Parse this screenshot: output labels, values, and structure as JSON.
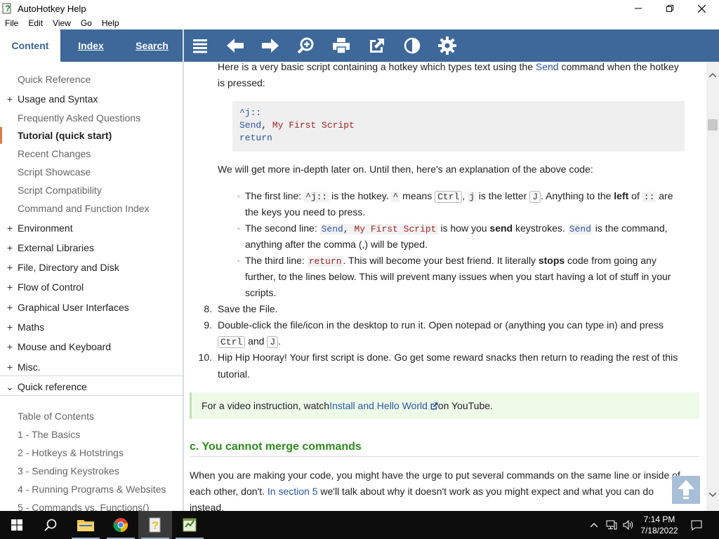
{
  "window": {
    "title": "AutoHotkey Help"
  },
  "menu": [
    "File",
    "Edit",
    "View",
    "Go",
    "Help"
  ],
  "tabs": {
    "content": "Content",
    "index": "Index",
    "search": "Search"
  },
  "sidebar": {
    "items": [
      {
        "label": "Quick Reference",
        "expander": ""
      },
      {
        "label": "Usage and Syntax",
        "expander": "+"
      },
      {
        "label": "Frequently Asked Questions",
        "expander": ""
      },
      {
        "label": "Tutorial (quick start)",
        "expander": ""
      },
      {
        "label": "Recent Changes",
        "expander": ""
      },
      {
        "label": "Script Showcase",
        "expander": ""
      },
      {
        "label": "Script Compatibility",
        "expander": ""
      },
      {
        "label": "Command and Function Index",
        "expander": ""
      },
      {
        "label": "Environment",
        "expander": "+"
      },
      {
        "label": "External Libraries",
        "expander": "+"
      },
      {
        "label": "File, Directory and Disk",
        "expander": "+"
      },
      {
        "label": "Flow of Control",
        "expander": "+"
      },
      {
        "label": "Graphical User Interfaces",
        "expander": "+"
      },
      {
        "label": "Maths",
        "expander": "+"
      },
      {
        "label": "Mouse and Keyboard",
        "expander": "+"
      },
      {
        "label": "Misc.",
        "expander": "+"
      }
    ],
    "quickref": {
      "label": "Quick reference",
      "expander": "⌄"
    },
    "toc": [
      "Table of Contents",
      "1 - The Basics",
      "2 - Hotkeys & Hotstrings",
      "3 - Sending Keystrokes",
      "4 - Running Programs & Websites",
      "5 - Commands vs. Functions()"
    ]
  },
  "content": {
    "intro_a": "Here is a very basic script containing a hotkey which types text using the ",
    "intro_link": "Send",
    "intro_b": " command when the hotkey",
    "intro_c": "is pressed:",
    "code": {
      "line1": "^j::",
      "line2_cmd": "Send",
      "line2_sep": ", ",
      "line2_arg": "My First Script",
      "line3": "return"
    },
    "explain": "We will get more in-depth later on. Until then, here's an explanation of the above code:",
    "b1": {
      "t1": "The first line: ",
      "c1": "^j::",
      "t2": " is the hotkey. ",
      "c2": "^",
      "t3": " means ",
      "k1": "Ctrl",
      "t4": ", ",
      "c3": "j",
      "t5": " is the letter ",
      "k2": "J",
      "t6": ". Anything to the ",
      "bold": "left",
      "t7": " of ",
      "c4": "::",
      "t8": " are",
      "line2": "the keys you need to press."
    },
    "b2": {
      "t1": "The second line: ",
      "c1": "Send",
      "c1b": ", ",
      "c1c": "My First Script",
      "t2": " is how you ",
      "bold": "send",
      "t3": " keystrokes. ",
      "c2": "Send",
      "t4": " is the command,",
      "line2": "anything after the comma (,) will be typed."
    },
    "b3": {
      "t1": "The third line: ",
      "c1": "return",
      "t2": ". This will become your best friend. It literally ",
      "bold": "stops",
      "t3": " code from going any",
      "line2": "further, to the lines below. This will prevent many issues when you start having a lot of stuff in your",
      "line3": "scripts."
    },
    "s8": {
      "num": "8.",
      "text": "Save the File."
    },
    "s9": {
      "num": "9.",
      "text": "Double-click the file/icon in the desktop to run it. Open notepad or (anything you can type in) and press",
      "k1": "Ctrl",
      "and": " and ",
      "k2": "J",
      "end": "."
    },
    "s10": {
      "num": "10.",
      "text": "Hip Hip Hooray! Your first script is done. Go get some reward snacks then return to reading the rest of this",
      "line2": "tutorial."
    },
    "note": {
      "t1": "For a video instruction, watch ",
      "link": "Install and Hello World",
      "t2": " on YouTube."
    },
    "heading": "c. You cannot merge commands",
    "para1": "When you are making your code, you might have the urge to put several commands on the same line or inside of",
    "para2a": "each other, don't. ",
    "para2link": "In section 5",
    "para2b": " we'll talk about why it doesn't work as you might expect and what you can do",
    "para3": "instead."
  },
  "taskbar": {
    "time": "7:14 PM",
    "date": "7/18/2022"
  },
  "colors": {
    "header_blue": "#3d6899",
    "accent_orange": "#d97d4a",
    "heading_green": "#2e8b1e",
    "link_blue": "#2b57a0"
  }
}
